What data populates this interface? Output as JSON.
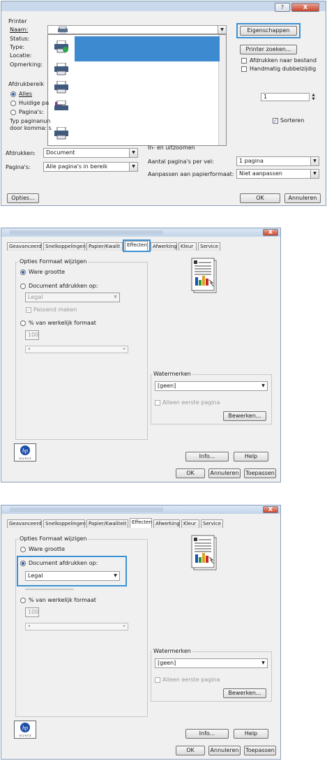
{
  "print_dialog": {
    "titlebar_help": "?",
    "titlebar_close": "X",
    "printer_group": "Printer",
    "name_label": "Naam:",
    "status_label": "Status:",
    "type_label": "Type:",
    "location_label": "Locatie:",
    "comment_label": "Opmerking:",
    "properties_button": "Eigenschappen",
    "find_printer_button": "Printer zoeken...",
    "print_to_file": "Afdrukken naar bestand",
    "manual_duplex": "Handmatig dubbelzijdig",
    "range_group": "Afdrukbereik",
    "range_all": "Alles",
    "range_current": "Huidige pa",
    "range_pages": "Pagina's:",
    "range_hint_1": "Typ paginanun",
    "range_hint_2": "door komma: s",
    "copies_value": "1",
    "collate": "Sorteren",
    "zoom_group": "In- en uitzoomen",
    "print_what_label": "Afdrukken:",
    "print_what_value": "Document",
    "pages_label": "Pagina's:",
    "pages_value": "Alle pagina's in bereik",
    "pages_per_sheet_label": "Aantal pagina's per vel:",
    "pages_per_sheet_value": "1 pagina",
    "scale_label": "Aanpassen aan papierformaat:",
    "scale_value": "Niet aanpassen",
    "options_button": "Opties...",
    "ok_button": "OK",
    "cancel_button": "Annuleren"
  },
  "props1": {
    "close": "X",
    "tabs": [
      "Geavanceerd",
      "Snelkoppelingen",
      "Papier/Kwalit",
      "Effecten",
      "Afwerking",
      "Kleur",
      "Service"
    ],
    "resize_group": "Opties Formaat wijzigen",
    "actual_size": "Ware grootte",
    "print_on": "Document afdrukken op:",
    "paper_value": "Legal",
    "fit": "Passend maken",
    "percent": "% van werkelijk formaat",
    "percent_value": "100",
    "watermark_group": "Watermerken",
    "watermark_value": "[geen]",
    "first_page_only": "Alleen eerste pagina",
    "edit_button": "Bewerken...",
    "info_button": "Info...",
    "help_button": "Help",
    "ok_button": "OK",
    "cancel_button": "Annuleren",
    "apply_button": "Toepassen",
    "logo": "hp",
    "logo_sub": "invent"
  },
  "props2": {
    "close": "X",
    "tabs": [
      "Geavanceerd",
      "Snelkoppelingen",
      "Papier/Kwaliteit",
      "Effecten",
      "Afwerking",
      "Kleur",
      "Service"
    ],
    "resize_group": "Opties Formaat wijzigen",
    "actual_size": "Ware grootte",
    "print_on": "Document afdrukken op:",
    "paper_value": "Legal",
    "percent": "% van werkelijk formaat",
    "percent_value": "100",
    "watermark_group": "Watermerken",
    "watermark_value": "[geen]",
    "first_page_only": "Alleen eerste pagina",
    "edit_button": "Bewerken...",
    "info_button": "Info...",
    "help_button": "Help",
    "ok_button": "OK",
    "cancel_button": "Annuleren",
    "apply_button": "Toepassen",
    "logo": "hp",
    "logo_sub": "invent"
  },
  "colors": {
    "highlight": "#3a91d4",
    "selection": "#3d8ad0",
    "close": "#c8452c"
  }
}
